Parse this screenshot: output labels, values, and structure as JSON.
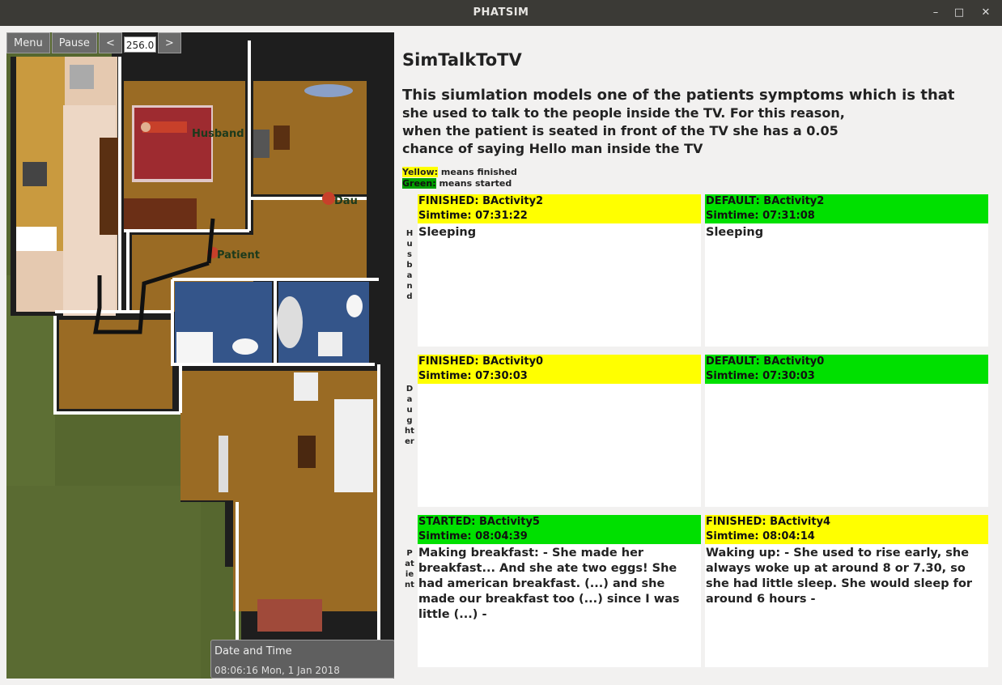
{
  "window": {
    "title": "PHATSIM"
  },
  "toolbar": {
    "menu": "Menu",
    "pause": "Pause",
    "prev": "<",
    "speed": "256.0",
    "next": ">"
  },
  "scene": {
    "labels": {
      "husband": "Husband",
      "daughter": "Dau",
      "patient": "Patient"
    }
  },
  "datetime": {
    "label": "Date and Time",
    "value": "08:06:16 Mon, 1 Jan 2018"
  },
  "sim": {
    "title": "SimTalkToTV",
    "desc_line1": "This siumlation models one of the patients symptoms which is that",
    "desc_line2": "she used to talk to the people inside the TV. For this reason,",
    "desc_line3": "when the patient is seated in front of the TV she has a 0.05",
    "desc_line4": "chance of saying Hello man inside the TV"
  },
  "legend": {
    "yellow_key": "Yellow:",
    "yellow_text": " means finished",
    "green_key": "Green:",
    "green_text": " means started"
  },
  "rows": [
    {
      "label": "Husband",
      "cards": [
        {
          "status": "FINISHED: BActivity2",
          "time": "Simtime:   07:31:22",
          "text": "Sleeping",
          "color": "#ffff00"
        },
        {
          "status": "DEFAULT: BActivity2",
          "time": "Simtime:   07:31:08",
          "text": "Sleeping",
          "color": "#00e000"
        }
      ]
    },
    {
      "label": "Daughter",
      "cards": [
        {
          "status": "FINISHED: BActivity0",
          "time": "Simtime:   07:30:03",
          "text": "",
          "color": "#ffff00"
        },
        {
          "status": "DEFAULT: BActivity0",
          "time": "Simtime:   07:30:03",
          "text": "",
          "color": "#00e000"
        }
      ]
    },
    {
      "label": "Patient",
      "cards": [
        {
          "status": "STARTED: BActivity5",
          "time": "Simtime:   08:04:39",
          "text": "Making breakfast: - She made her breakfast... And she ate two eggs! She had american breakfast. (...) and she made our breakfast too (...) since I was little (...)  -",
          "color": "#00e000"
        },
        {
          "status": "FINISHED: BActivity4",
          "time": "Simtime:   08:04:14",
          "text": "Waking up: - She used to rise early, she always woke up at around 8 or 7.30, so she had little sleep. She would sleep for around 6 hours  -",
          "color": "#ffff00"
        }
      ]
    }
  ]
}
